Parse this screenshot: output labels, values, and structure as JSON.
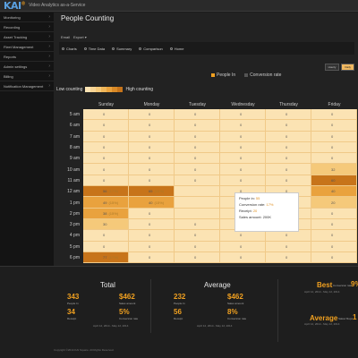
{
  "app": {
    "logo": "KAI",
    "logo_sup": "®",
    "tagline": "Video Analytics as-a-Service"
  },
  "sidebar": {
    "items": [
      {
        "label": "Monitoring"
      },
      {
        "label": "Recording"
      },
      {
        "label": "Asset Tracking"
      },
      {
        "label": "Fleet Management"
      },
      {
        "label": "Reports"
      },
      {
        "label": "Admin settings"
      },
      {
        "label": "Billing"
      },
      {
        "label": "Notification Management"
      }
    ]
  },
  "main": {
    "title": "People Counting",
    "toolbar": {
      "email_label": "Email",
      "export_label": "Export ▾"
    },
    "tabs": [
      "Charts",
      "Time Data",
      "Summary",
      "Comparison",
      "Home"
    ],
    "buttons": [
      "Hourly",
      "Daily"
    ],
    "legend": {
      "people_in": "People In",
      "conversion_rate": "Conversion rate"
    },
    "scale": {
      "low": "Low counting",
      "high": "High counting"
    }
  },
  "heatmap": {
    "days": [
      "Sunday",
      "Monday",
      "Tuesday",
      "Wednesday",
      "Thursday",
      "Friday"
    ],
    "hours": [
      "5 am",
      "6 am",
      "7 am",
      "8 am",
      "9 am",
      "10 am",
      "11 am",
      "12 am",
      "1 pm",
      "2 pm",
      "3 pm",
      "4 pm",
      "5 pm",
      "6 pm"
    ],
    "cells": [
      [
        "0",
        "0",
        "0",
        "0",
        "0",
        "0"
      ],
      [
        "0",
        "0",
        "0",
        "0",
        "0",
        "0"
      ],
      [
        "0",
        "0",
        "0",
        "0",
        "0",
        "0"
      ],
      [
        "0",
        "0",
        "0",
        "0",
        "0",
        "0"
      ],
      [
        "0",
        "0",
        "0",
        "0",
        "0",
        "0"
      ],
      [
        "0",
        "0",
        "0",
        "0",
        "0",
        "32"
      ],
      [
        "0",
        "0",
        "0",
        "0",
        "0",
        "60"
      ],
      [
        "56 (17%)",
        "65 (15%)",
        "",
        "0",
        "0",
        "40"
      ],
      [
        "49 (15%)",
        "40 (15%)",
        "",
        "0",
        "0",
        "20"
      ],
      [
        "38 (15%)",
        "0",
        "",
        "0",
        "0",
        "0"
      ],
      [
        "30",
        "0",
        "0",
        "0",
        "0",
        "0"
      ],
      [
        "0",
        "0",
        "0",
        "0",
        "0",
        "0"
      ],
      [
        "0",
        "0",
        "0",
        "0",
        "0",
        "0"
      ],
      [
        "77 (17%)",
        "0",
        "0",
        "0",
        "0",
        "0"
      ]
    ]
  },
  "tooltip": {
    "people_in_label": "People in:",
    "people_in": "55",
    "conversion_label": "Conversion rate:",
    "conversion": "17%",
    "receipt_label": "Receipt:",
    "receipt": "20",
    "sales_label": "Sales amount:",
    "sales": "200K"
  },
  "footer": {
    "total": {
      "title": "Total",
      "people": "343",
      "people_label": "People In",
      "sales": "$462",
      "sales_label": "Sales amount",
      "receipt": "34",
      "receipt_label": "Receipt",
      "conv": "5%",
      "conv_label": "Conversion rate",
      "range": "April 12, 2014 - May 12, 2014"
    },
    "average": {
      "title": "Average",
      "people": "232",
      "people_label": "People In",
      "sales": "$462",
      "sales_label": "Sales amount",
      "receipt": "56",
      "receipt_label": "Receipt",
      "conv": "8%",
      "conv_label": "Conversion rate",
      "range": "April 12, 2014 - May 12, 2014"
    },
    "best": {
      "title": "Best",
      "sub": "Conversion rate",
      "val": "9%",
      "range": "April 12, 2014 - May 12, 2014"
    },
    "average2": {
      "title": "Average",
      "sub": "Sales/ Repo",
      "val": "1",
      "range": "April 12, 2014 - May 12, 2014"
    },
    "copyright": "Copyright ©2014 KAI Square. All Rights Reserved."
  },
  "colors": {
    "accent": "#f0a020",
    "cell_base": "#fbe3b3",
    "cell_mid": "#f5c97a",
    "cell_high": "#e9a23e",
    "cell_peak": "#c7741a"
  }
}
